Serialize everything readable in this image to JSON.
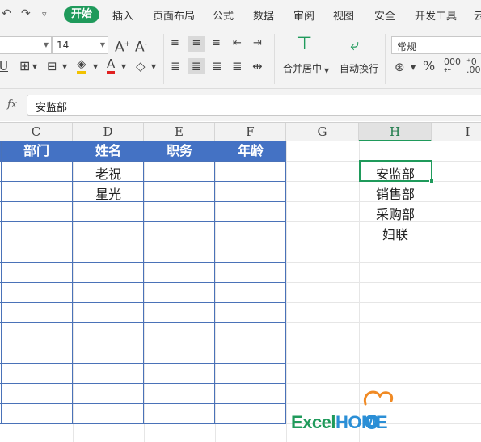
{
  "ribbon": {
    "tabs": [
      "开始",
      "插入",
      "页面布局",
      "公式",
      "数据",
      "审阅",
      "视图",
      "安全",
      "开发工具",
      "云"
    ],
    "active_tab": "开始"
  },
  "toolbar": {
    "font_size": "14",
    "merge_center_label": "合并居中",
    "wrap_text_label": "自动换行",
    "number_format": "常规"
  },
  "formula_bar": {
    "fx_label": "fx",
    "value": "安监部"
  },
  "sheet": {
    "columns": [
      "C",
      "D",
      "E",
      "F",
      "G",
      "H",
      "I"
    ],
    "active_column": "H",
    "table": {
      "headers": [
        "部门",
        "姓名",
        "职务",
        "年龄"
      ],
      "rows": [
        [
          "",
          "老祝",
          "",
          ""
        ],
        [
          "",
          "星光",
          "",
          ""
        ]
      ]
    },
    "h_column_values": [
      "安监部",
      "销售部",
      "采购部",
      "妇联"
    ]
  },
  "watermark": {
    "text_part1": "Excel",
    "text_part2": "HOME"
  },
  "colors": {
    "accent_green": "#1f9a5b",
    "table_header_blue": "#4472c4",
    "table_border_blue": "#4a72b8"
  }
}
